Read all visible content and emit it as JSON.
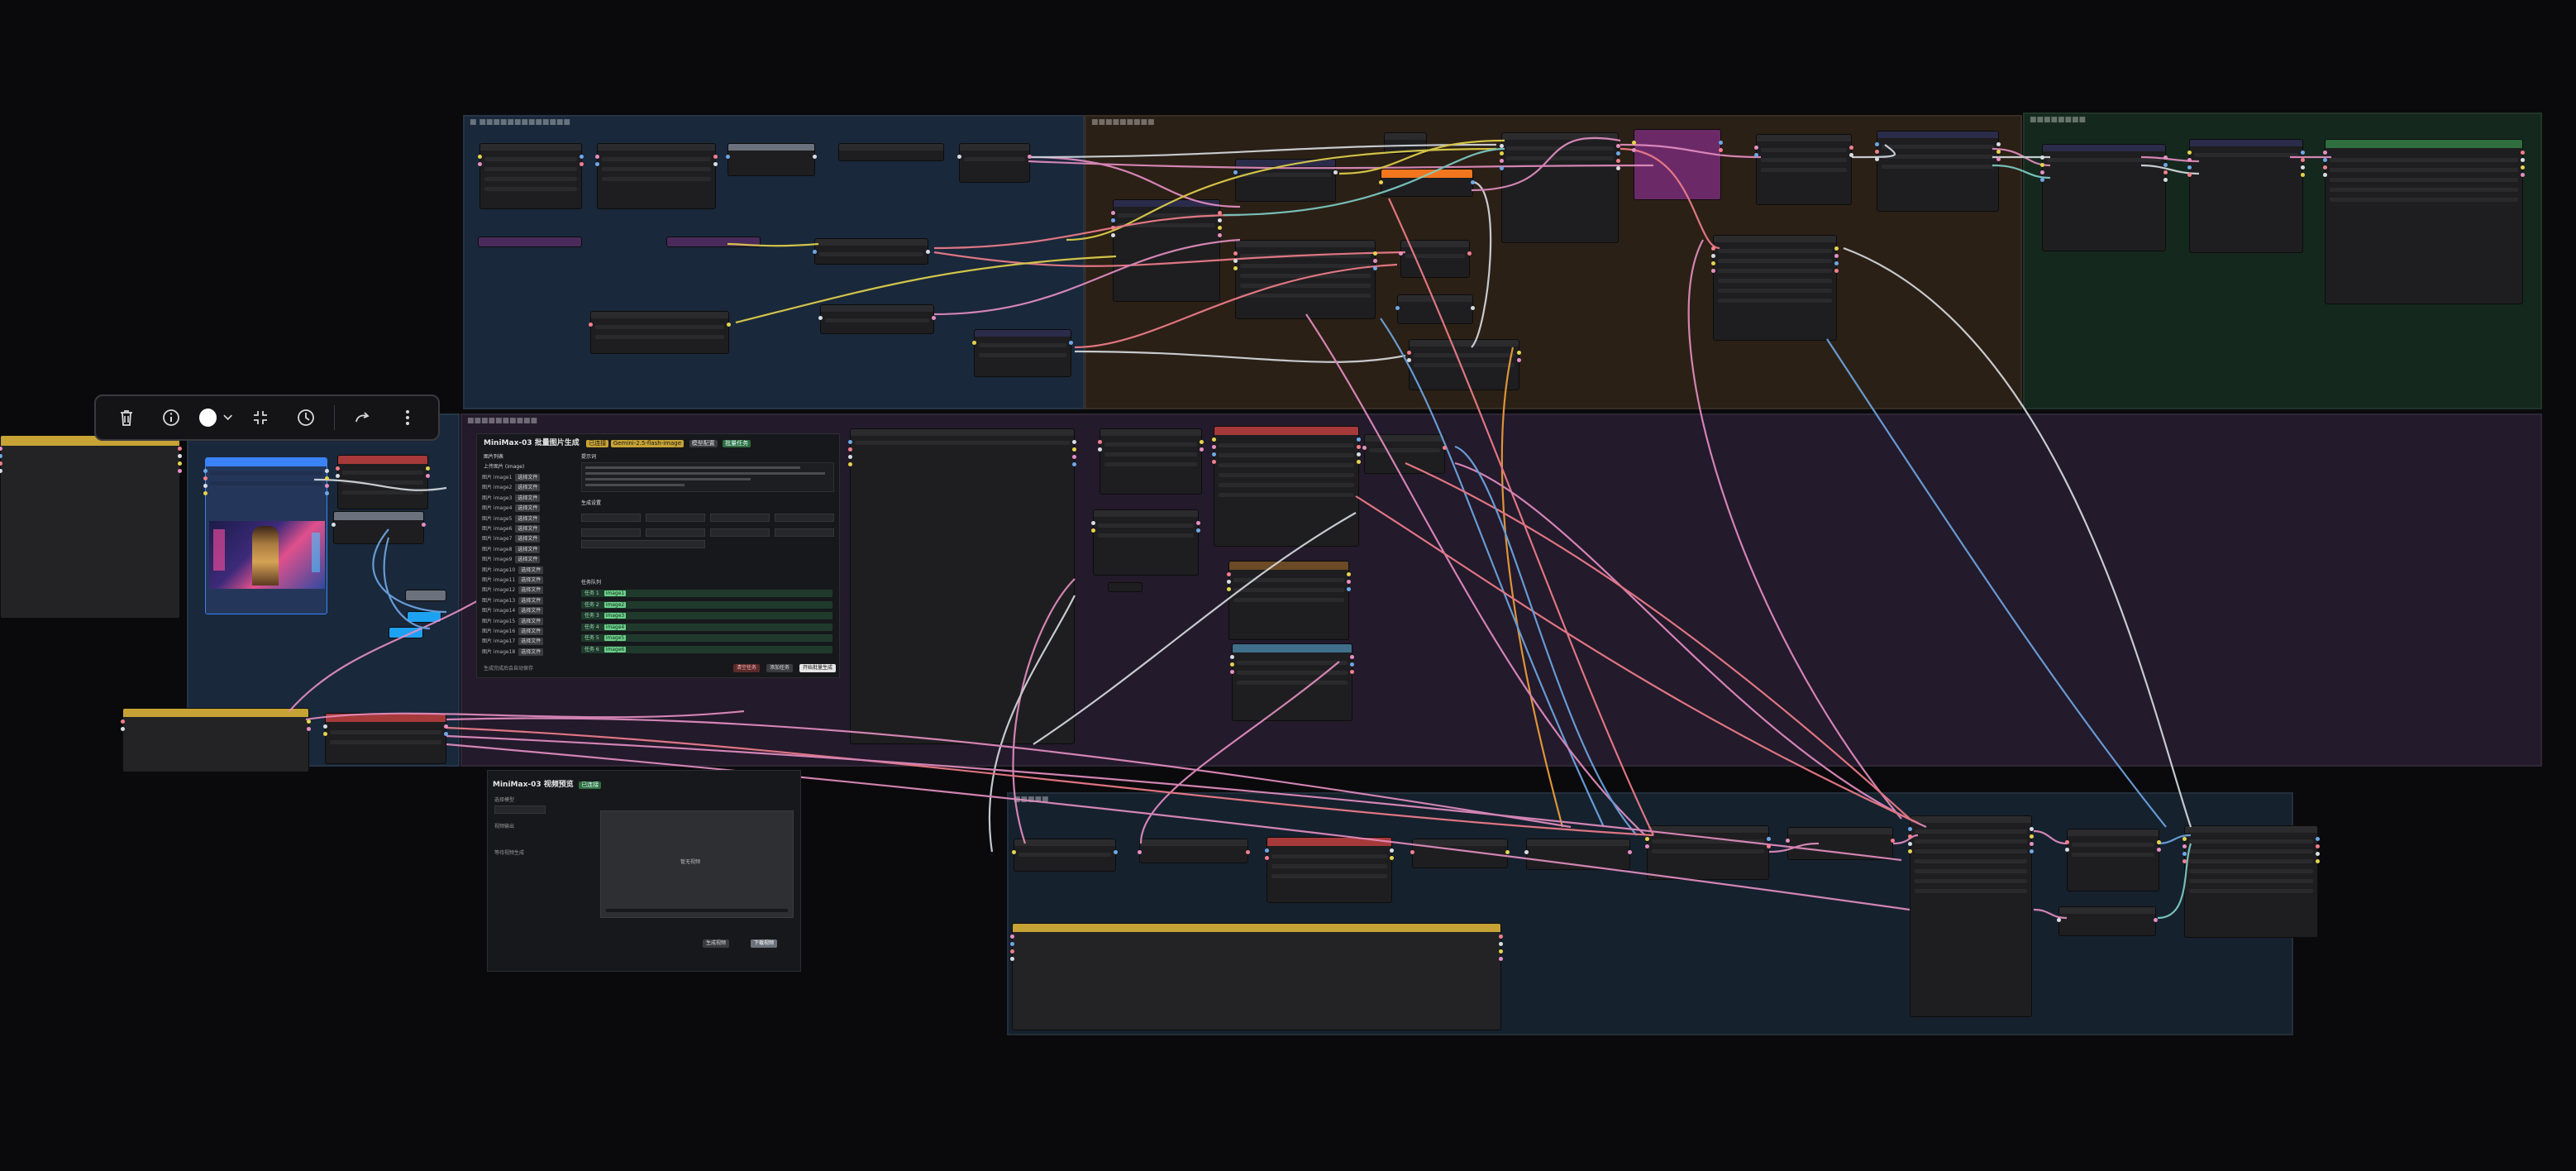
{
  "canvas": {
    "background": "#0a0a0c"
  },
  "toolbar": {
    "delete_icon": "trash-icon",
    "info_icon": "info-icon",
    "color_icon": "color-circle-icon",
    "selected_color": "#ffffff",
    "fit_icon": "collapse-icon",
    "bypass_icon": "bypass-icon",
    "redo_icon": "redo-icon",
    "more_icon": "more-vertical-icon"
  },
  "colors": {
    "group_blue": "#19283a",
    "group_brown": "#2b2016",
    "group_green": "#15281d",
    "group_purple": "#231a2b",
    "group_blue_bottom": "#16212e",
    "header_red": "#a63a3a",
    "header_yellow": "#c7a335",
    "header_blue": "#3b82f6",
    "header_orange": "#f2761d",
    "header_magenta": "#6b2a67",
    "header_green": "#2f6e3f",
    "header_teal": "#3f6f8a",
    "header_brownish": "#6b4a25",
    "wire_pink": "#e78fc4",
    "wire_salmon": "#f47f8c",
    "wire_blue": "#6fa8e6",
    "wire_yellow": "#e5d44c",
    "wire_white": "#d8dde2",
    "wire_orange": "#f2a23b",
    "wire_teal": "#7fd0c8"
  },
  "main_panel": {
    "title": "MiniMax-03 批量图片生成",
    "badge_a": "已连接",
    "badge_b": "Gemini-2.5-flash-image",
    "badge_c": "模型配置",
    "badge_d": "批量任务",
    "left_section": "图片列表",
    "left_hint": "上传图片 (image)",
    "list_rows": [
      {
        "label": "图片 image1",
        "btn": "选择文件"
      },
      {
        "label": "图片 image2",
        "btn": "选择文件"
      },
      {
        "label": "图片 image3",
        "btn": "选择文件"
      },
      {
        "label": "图片 image4",
        "btn": "选择文件"
      },
      {
        "label": "图片 image5",
        "btn": "选择文件"
      },
      {
        "label": "图片 image6",
        "btn": "选择文件"
      },
      {
        "label": "图片 image7",
        "btn": "选择文件"
      },
      {
        "label": "图片 image8",
        "btn": "选择文件"
      },
      {
        "label": "图片 image9",
        "btn": "选择文件"
      },
      {
        "label": "图片 image10",
        "btn": "选择文件"
      },
      {
        "label": "图片 image11",
        "btn": "选择文件"
      },
      {
        "label": "图片 image12",
        "btn": "选择文件"
      },
      {
        "label": "图片 image13",
        "btn": "选择文件"
      },
      {
        "label": "图片 image14",
        "btn": "选择文件"
      },
      {
        "label": "图片 image15",
        "btn": "选择文件"
      },
      {
        "label": "图片 image16",
        "btn": "选择文件"
      },
      {
        "label": "图片 image17",
        "btn": "选择文件"
      },
      {
        "label": "图片 image18",
        "btn": "选择文件"
      }
    ],
    "right_section": "提示词",
    "settings_section": "生成设置",
    "tasks_section": "任务队列",
    "task_rows": [
      {
        "label": "任务 1",
        "tag": "image1"
      },
      {
        "label": "任务 2",
        "tag": "image2"
      },
      {
        "label": "任务 3",
        "tag": "image3"
      },
      {
        "label": "任务 4",
        "tag": "image4"
      },
      {
        "label": "任务 5",
        "tag": "image5"
      },
      {
        "label": "任务 6",
        "tag": "image6"
      }
    ],
    "btn_clear": "清空任务",
    "btn_add": "添加任务",
    "btn_run": "开始批量生成",
    "footer_note": "生成完成后会自动保存"
  },
  "bottom_panel": {
    "title": "MiniMax-03 视频预览",
    "badge": "已连接",
    "status": "等待视频生成",
    "label_a": "选择模型",
    "label_b": "视频输出",
    "preview_text": "暂无视频",
    "btn_a": "生成视频",
    "btn_b": "下载视频"
  }
}
